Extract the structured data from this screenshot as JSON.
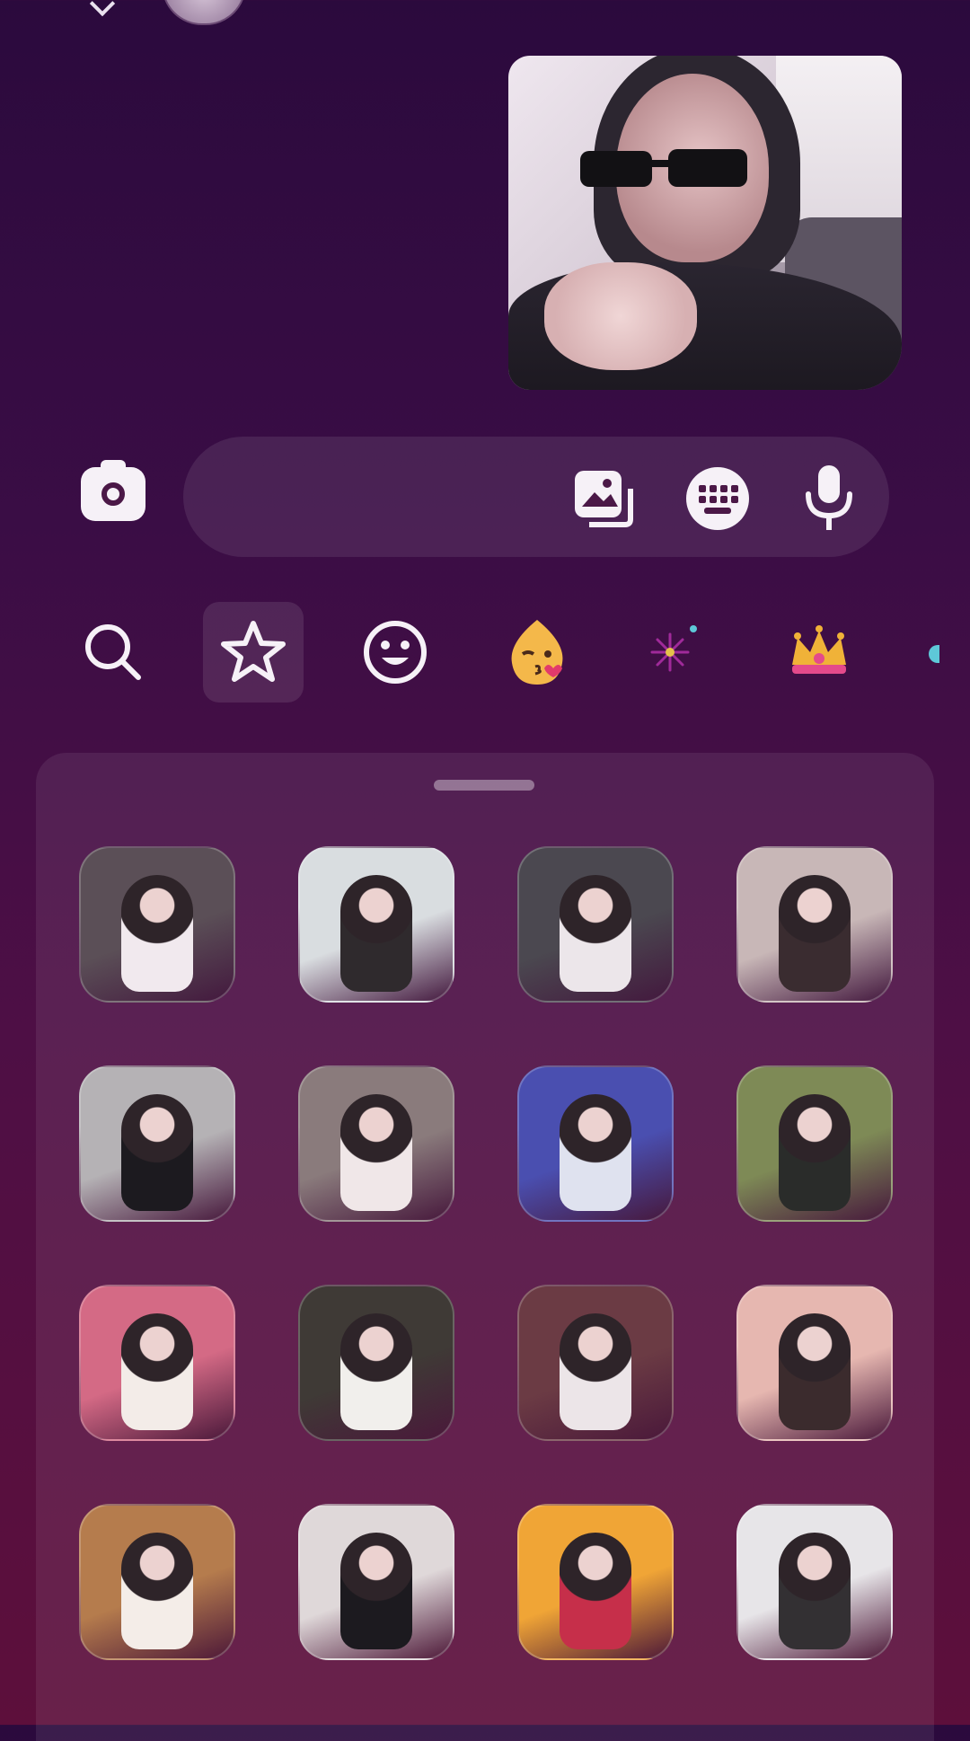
{
  "colors": {
    "background_top": "#2b0a3d",
    "background_bottom": "#5d0f3b",
    "icon_light": "#f6f1f7"
  },
  "composer": {
    "placeholder": ""
  },
  "icons": {
    "camera": "camera-icon",
    "gallery": "gallery-icon",
    "keyboard": "keyboard-icon",
    "mic": "microphone-icon"
  },
  "category_tabs": [
    {
      "name": "search-tab",
      "icon": "search-icon",
      "selected": false
    },
    {
      "name": "favorites-tab",
      "icon": "star-icon",
      "selected": true
    },
    {
      "name": "emoji-tab",
      "icon": "smiley-icon",
      "selected": false
    },
    {
      "name": "kiss-emoji-tab",
      "icon": "kiss-face-icon",
      "selected": false
    },
    {
      "name": "sparkle-tab",
      "icon": "sparkle-icon",
      "selected": false
    },
    {
      "name": "crown-tab",
      "icon": "crown-icon",
      "selected": false
    }
  ],
  "stickers": [
    {
      "bg": "#5b4f57",
      "accent": "#f1e9ee"
    },
    {
      "bg": "#d9dde0",
      "accent": "#2f2a2d"
    },
    {
      "bg": "#4b4850",
      "accent": "#ece6ea"
    },
    {
      "bg": "#c8b7b7",
      "accent": "#3a2c30"
    },
    {
      "bg": "#b5b2b5",
      "accent": "#1c1a1f"
    },
    {
      "bg": "#8a7b7c",
      "accent": "#f0e7e8"
    },
    {
      "bg": "#4a4fb0",
      "accent": "#dfe2ef"
    },
    {
      "bg": "#7e8a56",
      "accent": "#2a2c2a"
    },
    {
      "bg": "#d46a85",
      "accent": "#f3ece8"
    },
    {
      "bg": "#3f3a36",
      "accent": "#f1efec"
    },
    {
      "bg": "#6b3b44",
      "accent": "#ece5e8"
    },
    {
      "bg": "#e6b7b0",
      "accent": "#3b2b2d"
    },
    {
      "bg": "#b57c4d",
      "accent": "#f4ede8"
    },
    {
      "bg": "#dfd8d9",
      "accent": "#1c1a1f"
    },
    {
      "bg": "#f0a536",
      "accent": "#c62f4a"
    },
    {
      "bg": "#e7e5e8",
      "accent": "#333033"
    }
  ]
}
